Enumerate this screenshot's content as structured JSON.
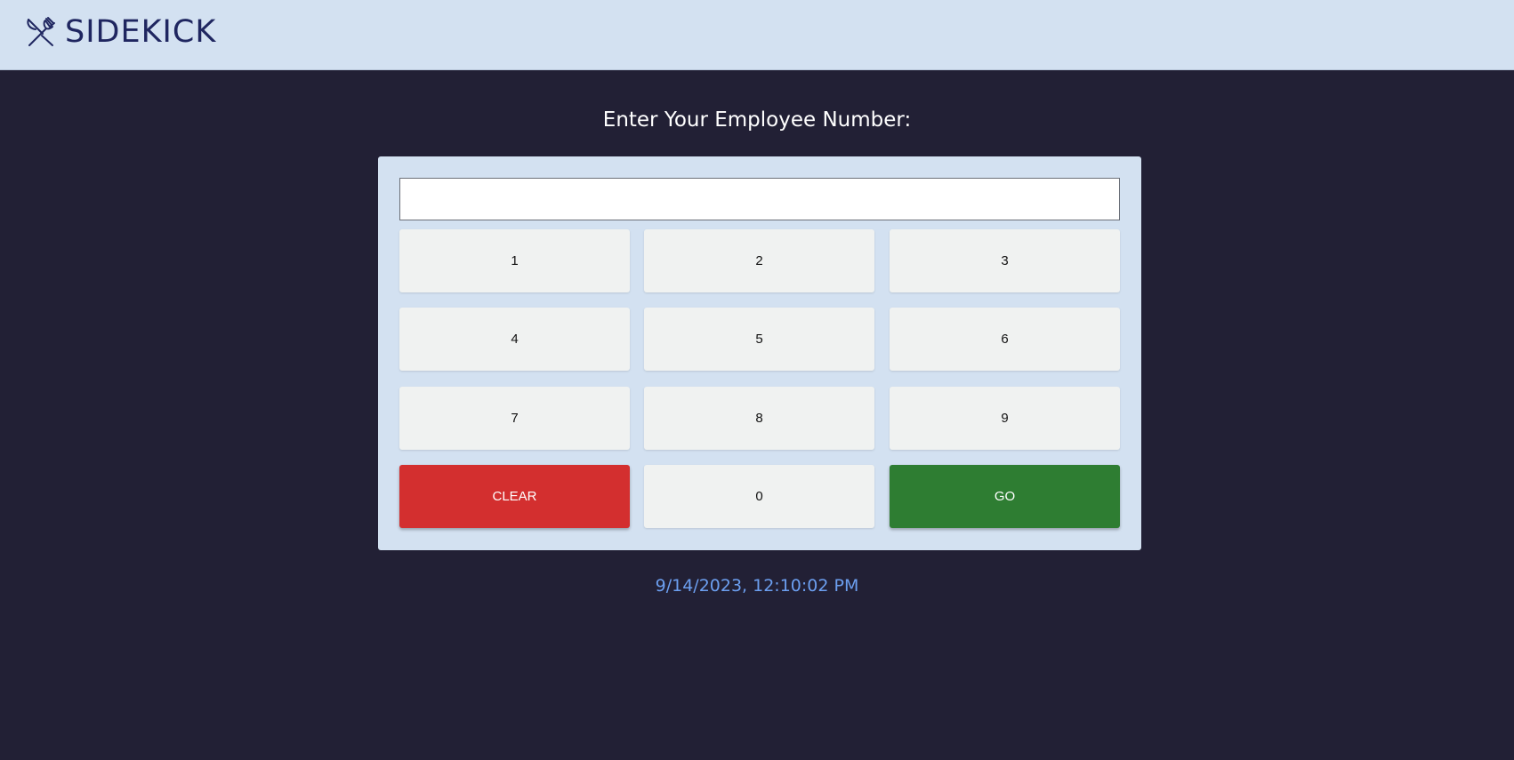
{
  "header": {
    "brand": "SIDEKICK",
    "logo_icon": "fork-knife-crossed-icon",
    "background": "#d3e1f1",
    "brand_color": "#1f2660"
  },
  "main": {
    "prompt": "Enter Your Employee Number:",
    "entry": {
      "value": "",
      "placeholder": ""
    },
    "keypad": {
      "keys": [
        "1",
        "2",
        "3",
        "4",
        "5",
        "6",
        "7",
        "8",
        "9"
      ],
      "clear_label": "CLEAR",
      "zero_label": "0",
      "go_label": "GO",
      "clear_color": "#d32f2f",
      "go_color": "#2e7d32"
    },
    "timestamp": "9/14/2023, 12:10:02 PM"
  },
  "colors": {
    "page_background": "#222035",
    "panel_background": "#d3e1f1",
    "key_background": "#f0f2f1",
    "timestamp_color": "#6c9ff0"
  }
}
